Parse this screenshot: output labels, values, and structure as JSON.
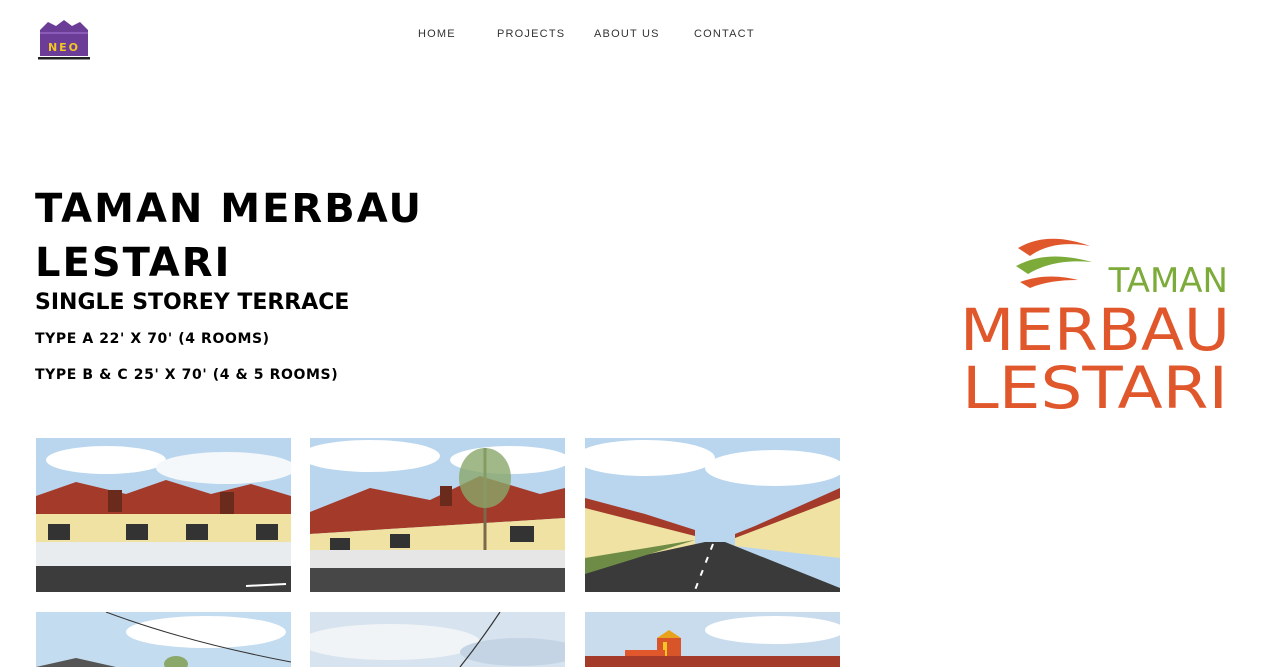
{
  "header": {
    "logo_text": "NEO",
    "nav": [
      {
        "label": "HOME"
      },
      {
        "label": "PROJECTS"
      },
      {
        "label": "ABOUT US"
      },
      {
        "label": "CONTACT"
      }
    ]
  },
  "project": {
    "title": "TAMAN MERBAU LESTARI",
    "subtitle": "SINGLE STOREY TERRACE",
    "type_a": "TYPE A 22' X 70' (4 ROOMS)",
    "type_b": "TYPE B & C 25' X 70' (4 & 5 ROOMS)"
  },
  "brand_logo": {
    "line1": "TAMAN",
    "line2": "MERBAU",
    "line3": "LESTARI"
  },
  "colors": {
    "brand_orange": "#e1572c",
    "brand_green": "#7cab3a",
    "logo_purple": "#6b3d97",
    "roof_red": "#a33a2a",
    "wall_yellow": "#efe2a2",
    "sky_blue": "#b9d6ee"
  },
  "gallery": {
    "photos": [
      {
        "icon": "house-photo"
      },
      {
        "icon": "house-photo"
      },
      {
        "icon": "street-photo"
      },
      {
        "icon": "house-photo"
      },
      {
        "icon": "sky-photo"
      },
      {
        "icon": "playground-photo"
      }
    ]
  }
}
